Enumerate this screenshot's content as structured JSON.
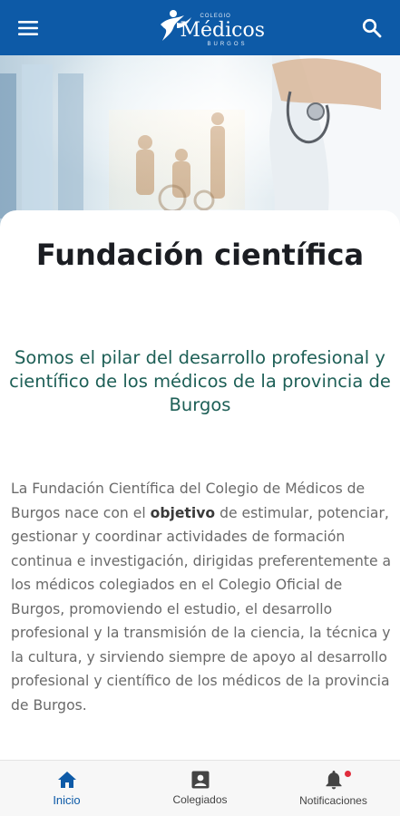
{
  "header": {
    "logo": {
      "small_text": "COLEGIO",
      "main_text": "Médicos",
      "city_text": "BURGOS"
    },
    "menu_icon": "menu-icon",
    "search_icon": "search-icon"
  },
  "page": {
    "title": "Fundación científica",
    "subtitle": "Somos el pilar del desarrollo profesional y científico de los médicos de la provincia de Burgos",
    "body_before": "La Fundación Científica del Colegio de Médicos de Burgos  nace con el ",
    "body_bold": "objetivo",
    "body_after": " de estimular, potenciar, gestionar y coordinar actividades de formación continua e investigación, dirigidas preferentemente a los médicos colegiados en el Colegio Oficial de Burgos, promoviendo el estudio, el desarrollo profesional y la transmisión de la ciencia, la técnica y la cultura, y sirviendo siempre de apoyo al desarrollo profesional y científico de los médicos de la provincia de Burgos."
  },
  "bottom_nav": {
    "items": [
      {
        "label": "Inicio",
        "icon": "home-icon",
        "active": true
      },
      {
        "label": "Colegiados",
        "icon": "badge-icon",
        "active": false
      },
      {
        "label": "Notificaciones",
        "icon": "bell-icon",
        "active": false,
        "has_badge": true
      }
    ]
  },
  "colors": {
    "primary": "#0d5aa7",
    "subtitle": "#1d5f56",
    "body": "#6a6a6a",
    "badge": "#e02c3c"
  }
}
